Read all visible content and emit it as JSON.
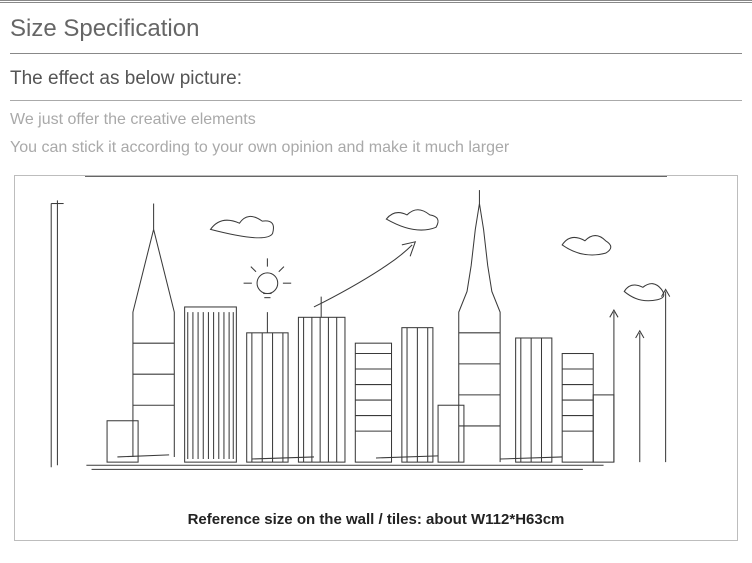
{
  "title": "Size Specification",
  "subtitle": "The effect as below picture:",
  "note1": "We just offer the creative elements",
  "note2": "You can stick it according to your own opinion and make it much larger",
  "caption": "Reference size on the wall / tiles: about W112*H63cm"
}
